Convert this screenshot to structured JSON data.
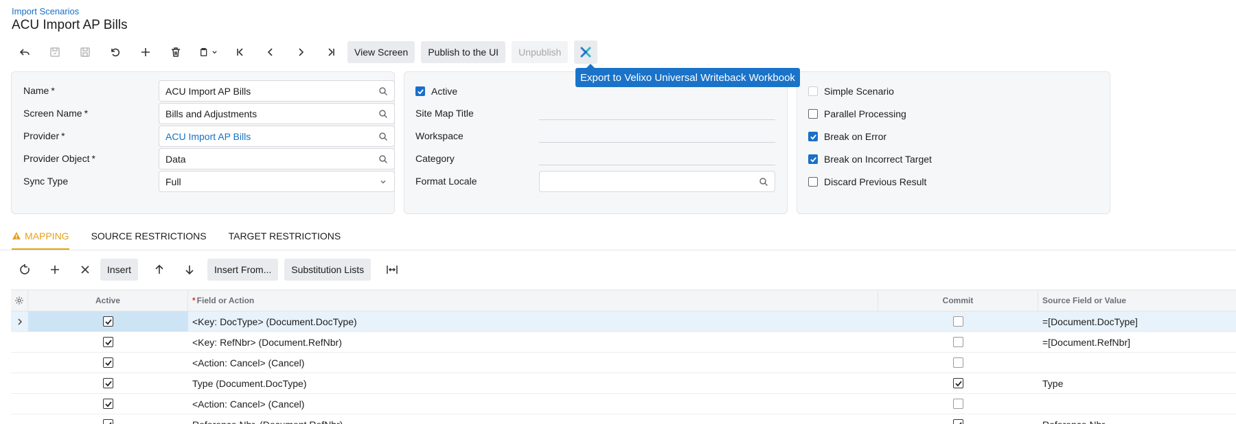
{
  "header": {
    "breadcrumb": "Import Scenarios",
    "title": "ACU Import AP Bills"
  },
  "toolbar": {
    "icons": [
      "back-icon",
      "save-close-icon",
      "save-icon",
      "undo-icon",
      "add-icon",
      "delete-icon",
      "clipboard-icon",
      "first-record-icon",
      "previous-record-icon",
      "next-record-icon",
      "last-record-icon"
    ],
    "view_screen": "View Screen",
    "publish": "Publish to the UI",
    "unpublish": "Unpublish",
    "extension_tooltip": "Export to Velixo Universal Writeback Workbook"
  },
  "form": {
    "name_label": "Name",
    "name_value": "ACU Import AP Bills",
    "screen_label": "Screen Name",
    "screen_value": "Bills and Adjustments",
    "provider_label": "Provider",
    "provider_value": "ACU Import AP Bills",
    "provider_object_label": "Provider Object",
    "provider_object_value": "Data",
    "sync_label": "Sync Type",
    "sync_value": "Full",
    "active_label": "Active",
    "sitemap_label": "Site Map Title",
    "workspace_label": "Workspace",
    "category_label": "Category",
    "locale_label": "Format Locale",
    "simple_label": "Simple Scenario",
    "parallel_label": "Parallel Processing",
    "break_error_label": "Break on Error",
    "break_target_label": "Break on Incorrect Target",
    "discard_label": "Discard Previous Result",
    "required_mark": "*"
  },
  "tabs": {
    "mapping": "MAPPING",
    "source": "SOURCE RESTRICTIONS",
    "target": "TARGET RESTRICTIONS"
  },
  "grid_toolbar": {
    "insert": "Insert",
    "insert_from": "Insert From...",
    "substitution": "Substitution Lists"
  },
  "grid": {
    "columns": {
      "active": "Active",
      "field": "Field or Action",
      "commit": "Commit",
      "source": "Source Field or Value",
      "required_mark": "*"
    },
    "rows": [
      {
        "active": true,
        "field": "<Key: DocType> (Document.DocType)",
        "commit": false,
        "source": "=[Document.DocType]"
      },
      {
        "active": true,
        "field": "<Key: RefNbr> (Document.RefNbr)",
        "commit": false,
        "source": "=[Document.RefNbr]"
      },
      {
        "active": true,
        "field": "<Action: Cancel> (Cancel)",
        "commit": false,
        "source": ""
      },
      {
        "active": true,
        "field": "Type (Document.DocType)",
        "commit": true,
        "source": "Type"
      },
      {
        "active": true,
        "field": "<Action: Cancel> (Cancel)",
        "commit": false,
        "source": ""
      },
      {
        "active": true,
        "field": "Reference Nbr. (Document.RefNbr)",
        "commit": true,
        "source": "Reference Nbr."
      }
    ]
  },
  "colors": {
    "accent": "#1a6fc9",
    "tab_active": "#e6a019",
    "link": "#1570c4"
  }
}
